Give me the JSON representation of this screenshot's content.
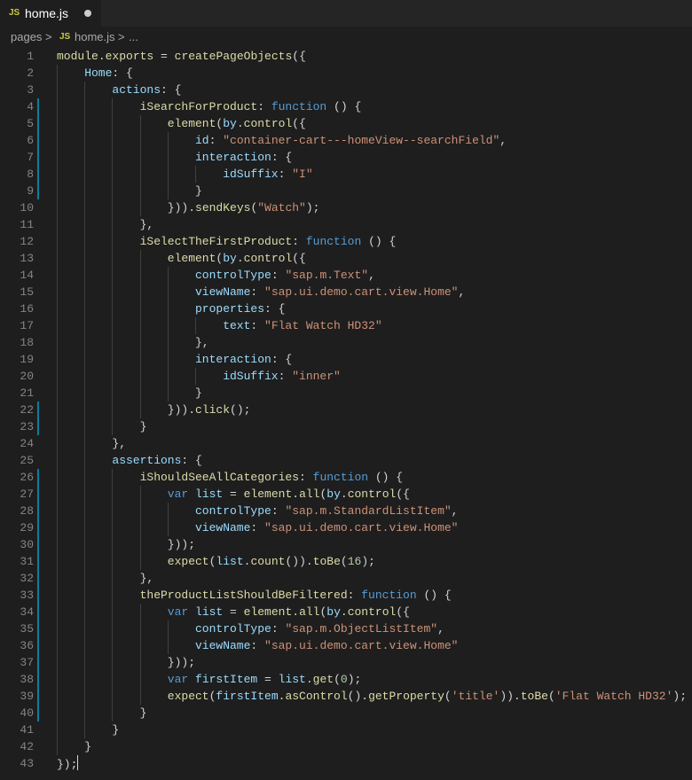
{
  "tab": {
    "icon": "JS",
    "label": "home.js",
    "modified_icon": "unsaved-dot-icon"
  },
  "breadcrumb": {
    "folder": "pages",
    "sep": ">",
    "icon": "JS",
    "file": "home.js",
    "sep2": ">",
    "more": "..."
  },
  "colors": {
    "property": "#9cdcfe",
    "function": "#dcdcaa",
    "keyword": "#569cd6",
    "string": "#ce9178",
    "number": "#b5cea8",
    "plain": "#d4d4d4"
  },
  "lines": [
    {
      "n": "1",
      "indent": 0,
      "mark": false,
      "tokens": [
        [
          "f",
          "module"
        ],
        [
          "p",
          "."
        ],
        [
          "f",
          "exports"
        ],
        [
          "p",
          " = "
        ],
        [
          "f",
          "createPageObjects"
        ],
        [
          "p",
          "({"
        ]
      ]
    },
    {
      "n": "2",
      "indent": 1,
      "mark": false,
      "tokens": [
        [
          "v",
          "Home"
        ],
        [
          "p",
          ": {"
        ]
      ]
    },
    {
      "n": "3",
      "indent": 2,
      "mark": false,
      "tokens": [
        [
          "v",
          "actions"
        ],
        [
          "p",
          ": {"
        ]
      ]
    },
    {
      "n": "4",
      "indent": 3,
      "mark": true,
      "tokens": [
        [
          "f",
          "iSearchForProduct"
        ],
        [
          "p",
          ": "
        ],
        [
          "k",
          "function"
        ],
        [
          "p",
          " () {"
        ]
      ]
    },
    {
      "n": "5",
      "indent": 4,
      "mark": true,
      "tokens": [
        [
          "f",
          "element"
        ],
        [
          "p",
          "("
        ],
        [
          "v",
          "by"
        ],
        [
          "p",
          "."
        ],
        [
          "f",
          "control"
        ],
        [
          "p",
          "({"
        ]
      ]
    },
    {
      "n": "6",
      "indent": 5,
      "mark": true,
      "tokens": [
        [
          "v",
          "id"
        ],
        [
          "p",
          ": "
        ],
        [
          "s",
          "\"container-cart---homeView--searchField\""
        ],
        [
          "p",
          ","
        ]
      ]
    },
    {
      "n": "7",
      "indent": 5,
      "mark": true,
      "tokens": [
        [
          "v",
          "interaction"
        ],
        [
          "p",
          ": {"
        ]
      ]
    },
    {
      "n": "8",
      "indent": 6,
      "mark": true,
      "tokens": [
        [
          "v",
          "idSuffix"
        ],
        [
          "p",
          ": "
        ],
        [
          "s",
          "\"I\""
        ]
      ]
    },
    {
      "n": "9",
      "indent": 5,
      "mark": true,
      "tokens": [
        [
          "p",
          "}"
        ]
      ]
    },
    {
      "n": "10",
      "indent": 4,
      "mark": false,
      "tokens": [
        [
          "p",
          "}))."
        ],
        [
          "f",
          "sendKeys"
        ],
        [
          "p",
          "("
        ],
        [
          "s",
          "\"Watch\""
        ],
        [
          "p",
          ");"
        ]
      ]
    },
    {
      "n": "11",
      "indent": 3,
      "mark": false,
      "tokens": [
        [
          "p",
          "},"
        ]
      ]
    },
    {
      "n": "12",
      "indent": 3,
      "mark": false,
      "tokens": [
        [
          "f",
          "iSelectTheFirstProduct"
        ],
        [
          "p",
          ": "
        ],
        [
          "k",
          "function"
        ],
        [
          "p",
          " () {"
        ]
      ]
    },
    {
      "n": "13",
      "indent": 4,
      "mark": false,
      "tokens": [
        [
          "f",
          "element"
        ],
        [
          "p",
          "("
        ],
        [
          "v",
          "by"
        ],
        [
          "p",
          "."
        ],
        [
          "f",
          "control"
        ],
        [
          "p",
          "({"
        ]
      ]
    },
    {
      "n": "14",
      "indent": 5,
      "mark": false,
      "tokens": [
        [
          "v",
          "controlType"
        ],
        [
          "p",
          ": "
        ],
        [
          "s",
          "\"sap.m.Text\""
        ],
        [
          "p",
          ","
        ]
      ]
    },
    {
      "n": "15",
      "indent": 5,
      "mark": false,
      "tokens": [
        [
          "v",
          "viewName"
        ],
        [
          "p",
          ": "
        ],
        [
          "s",
          "\"sap.ui.demo.cart.view.Home\""
        ],
        [
          "p",
          ","
        ]
      ]
    },
    {
      "n": "16",
      "indent": 5,
      "mark": false,
      "tokens": [
        [
          "v",
          "properties"
        ],
        [
          "p",
          ": {"
        ]
      ]
    },
    {
      "n": "17",
      "indent": 6,
      "mark": false,
      "tokens": [
        [
          "v",
          "text"
        ],
        [
          "p",
          ": "
        ],
        [
          "s",
          "\"Flat Watch HD32\""
        ]
      ]
    },
    {
      "n": "18",
      "indent": 5,
      "mark": false,
      "tokens": [
        [
          "p",
          "},"
        ]
      ]
    },
    {
      "n": "19",
      "indent": 5,
      "mark": false,
      "tokens": [
        [
          "v",
          "interaction"
        ],
        [
          "p",
          ": {"
        ]
      ]
    },
    {
      "n": "20",
      "indent": 6,
      "mark": false,
      "tokens": [
        [
          "v",
          "idSuffix"
        ],
        [
          "p",
          ": "
        ],
        [
          "s",
          "\"inner\""
        ]
      ]
    },
    {
      "n": "21",
      "indent": 5,
      "mark": false,
      "tokens": [
        [
          "p",
          "}"
        ]
      ]
    },
    {
      "n": "22",
      "indent": 4,
      "mark": true,
      "tokens": [
        [
          "p",
          "}))."
        ],
        [
          "f",
          "click"
        ],
        [
          "p",
          "();"
        ]
      ]
    },
    {
      "n": "23",
      "indent": 3,
      "mark": true,
      "tokens": [
        [
          "p",
          "}"
        ]
      ]
    },
    {
      "n": "24",
      "indent": 2,
      "mark": false,
      "tokens": [
        [
          "p",
          "},"
        ]
      ]
    },
    {
      "n": "25",
      "indent": 2,
      "mark": false,
      "tokens": [
        [
          "v",
          "assertions"
        ],
        [
          "p",
          ": {"
        ]
      ]
    },
    {
      "n": "26",
      "indent": 3,
      "mark": true,
      "tokens": [
        [
          "f",
          "iShouldSeeAllCategories"
        ],
        [
          "p",
          ": "
        ],
        [
          "k",
          "function"
        ],
        [
          "p",
          " () {"
        ]
      ]
    },
    {
      "n": "27",
      "indent": 4,
      "mark": true,
      "tokens": [
        [
          "k",
          "var"
        ],
        [
          "p",
          " "
        ],
        [
          "v",
          "list"
        ],
        [
          "p",
          " = "
        ],
        [
          "f",
          "element"
        ],
        [
          "p",
          "."
        ],
        [
          "f",
          "all"
        ],
        [
          "p",
          "("
        ],
        [
          "v",
          "by"
        ],
        [
          "p",
          "."
        ],
        [
          "f",
          "control"
        ],
        [
          "p",
          "({"
        ]
      ]
    },
    {
      "n": "28",
      "indent": 5,
      "mark": true,
      "tokens": [
        [
          "v",
          "controlType"
        ],
        [
          "p",
          ": "
        ],
        [
          "s",
          "\"sap.m.StandardListItem\""
        ],
        [
          "p",
          ","
        ]
      ]
    },
    {
      "n": "29",
      "indent": 5,
      "mark": true,
      "tokens": [
        [
          "v",
          "viewName"
        ],
        [
          "p",
          ": "
        ],
        [
          "s",
          "\"sap.ui.demo.cart.view.Home\""
        ]
      ]
    },
    {
      "n": "30",
      "indent": 4,
      "mark": true,
      "tokens": [
        [
          "p",
          "}));"
        ]
      ]
    },
    {
      "n": "31",
      "indent": 4,
      "mark": true,
      "tokens": [
        [
          "f",
          "expect"
        ],
        [
          "p",
          "("
        ],
        [
          "v",
          "list"
        ],
        [
          "p",
          "."
        ],
        [
          "f",
          "count"
        ],
        [
          "p",
          "())."
        ],
        [
          "f",
          "toBe"
        ],
        [
          "p",
          "("
        ],
        [
          "n",
          "16"
        ],
        [
          "p",
          ");"
        ]
      ]
    },
    {
      "n": "32",
      "indent": 3,
      "mark": true,
      "tokens": [
        [
          "p",
          "},"
        ]
      ]
    },
    {
      "n": "33",
      "indent": 3,
      "mark": true,
      "tokens": [
        [
          "f",
          "theProductListShouldBeFiltered"
        ],
        [
          "p",
          ": "
        ],
        [
          "k",
          "function"
        ],
        [
          "p",
          " () {"
        ]
      ]
    },
    {
      "n": "34",
      "indent": 4,
      "mark": true,
      "tokens": [
        [
          "k",
          "var"
        ],
        [
          "p",
          " "
        ],
        [
          "v",
          "list"
        ],
        [
          "p",
          " = "
        ],
        [
          "f",
          "element"
        ],
        [
          "p",
          "."
        ],
        [
          "f",
          "all"
        ],
        [
          "p",
          "("
        ],
        [
          "v",
          "by"
        ],
        [
          "p",
          "."
        ],
        [
          "f",
          "control"
        ],
        [
          "p",
          "({"
        ]
      ]
    },
    {
      "n": "35",
      "indent": 5,
      "mark": true,
      "tokens": [
        [
          "v",
          "controlType"
        ],
        [
          "p",
          ": "
        ],
        [
          "s",
          "\"sap.m.ObjectListItem\""
        ],
        [
          "p",
          ","
        ]
      ]
    },
    {
      "n": "36",
      "indent": 5,
      "mark": true,
      "tokens": [
        [
          "v",
          "viewName"
        ],
        [
          "p",
          ": "
        ],
        [
          "s",
          "\"sap.ui.demo.cart.view.Home\""
        ]
      ]
    },
    {
      "n": "37",
      "indent": 4,
      "mark": true,
      "tokens": [
        [
          "p",
          "}));"
        ]
      ]
    },
    {
      "n": "38",
      "indent": 4,
      "mark": true,
      "tokens": [
        [
          "k",
          "var"
        ],
        [
          "p",
          " "
        ],
        [
          "v",
          "firstItem"
        ],
        [
          "p",
          " = "
        ],
        [
          "v",
          "list"
        ],
        [
          "p",
          "."
        ],
        [
          "f",
          "get"
        ],
        [
          "p",
          "("
        ],
        [
          "n",
          "0"
        ],
        [
          "p",
          ");"
        ]
      ]
    },
    {
      "n": "39",
      "indent": 4,
      "mark": true,
      "tokens": [
        [
          "f",
          "expect"
        ],
        [
          "p",
          "("
        ],
        [
          "v",
          "firstItem"
        ],
        [
          "p",
          "."
        ],
        [
          "f",
          "asControl"
        ],
        [
          "p",
          "()."
        ],
        [
          "f",
          "getProperty"
        ],
        [
          "p",
          "("
        ],
        [
          "s",
          "'title'"
        ],
        [
          "p",
          "))."
        ],
        [
          "f",
          "toBe"
        ],
        [
          "p",
          "("
        ],
        [
          "s",
          "'Flat Watch HD32'"
        ],
        [
          "p",
          ");"
        ]
      ]
    },
    {
      "n": "40",
      "indent": 3,
      "mark": true,
      "tokens": [
        [
          "p",
          "}"
        ]
      ]
    },
    {
      "n": "41",
      "indent": 2,
      "mark": false,
      "tokens": [
        [
          "p",
          "}"
        ]
      ]
    },
    {
      "n": "42",
      "indent": 1,
      "mark": false,
      "tokens": [
        [
          "p",
          "}"
        ]
      ]
    },
    {
      "n": "43",
      "indent": 0,
      "mark": false,
      "tokens": [
        [
          "p",
          "});"
        ]
      ],
      "cursor": true
    }
  ]
}
